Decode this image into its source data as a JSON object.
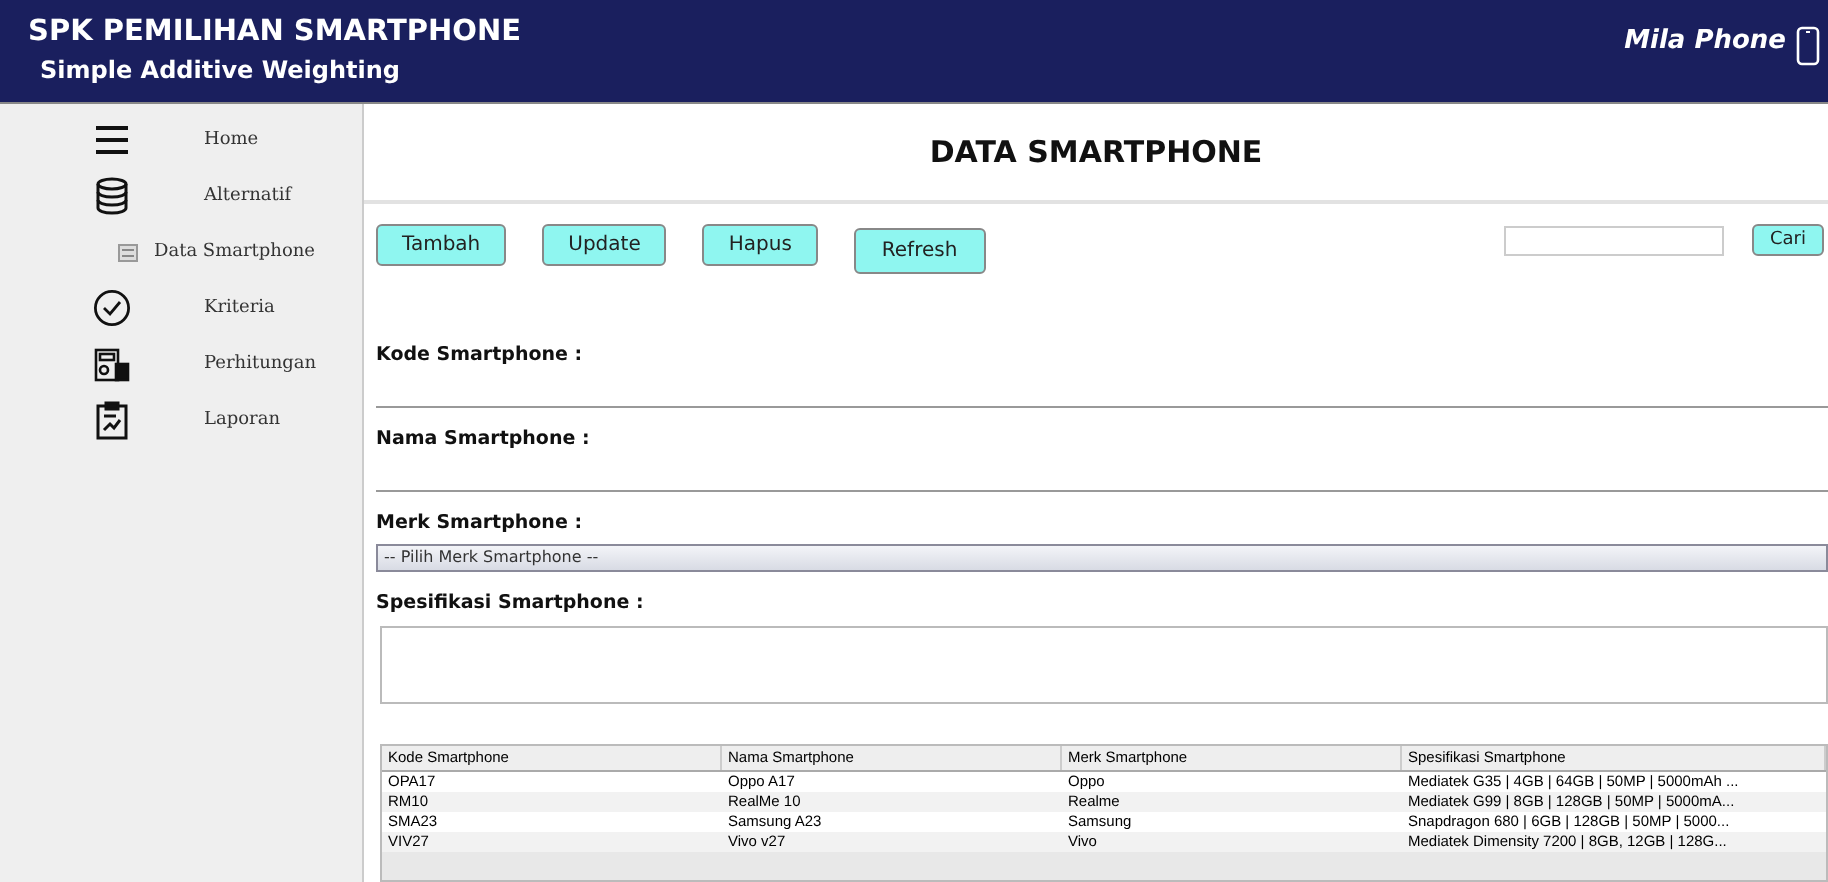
{
  "header": {
    "title": "SPK PEMILIHAN SMARTPHONE",
    "subtitle": "Simple Additive Weighting",
    "brand": "Mila Phone"
  },
  "sidebar": {
    "items": [
      {
        "label": "Home",
        "selected": false
      },
      {
        "label": "Alternatif",
        "selected": false,
        "children": [
          {
            "label": "Data Smartphone",
            "selected": false
          }
        ]
      },
      {
        "label": "Kriteria",
        "selected": false
      },
      {
        "label": "Perhitungan",
        "selected": false
      },
      {
        "label": "Laporan",
        "selected": false
      }
    ]
  },
  "page_title": "DATA SMARTPHONE",
  "buttons": [
    "Tambah",
    "Update",
    "Hapus",
    "Refresh"
  ],
  "search": {
    "button": "Cari"
  },
  "form": [
    {
      "kind": "line",
      "label": "Kode Smartphone :"
    },
    {
      "kind": "line",
      "label": "Nama Smartphone :"
    },
    {
      "kind": "select",
      "label": "Merk Smartphone :",
      "value": "-- Pilih Merk Smartphone --"
    },
    {
      "kind": "textarea",
      "label": "Spesifikasi Smartphone :"
    }
  ],
  "table": {
    "columns": [
      "Kode Smartphone",
      "Nama Smartphone",
      "Merk Smartphone",
      "Spesifikasi Smartphone"
    ],
    "rows": [
      [
        "OPA17",
        "Oppo A17",
        "Oppo",
        "Mediatek G35 | 4GB | 64GB | 50MP | 5000mAh ..."
      ],
      [
        "RM10",
        "RealMe 10",
        "Realme",
        "Mediatek G99 | 8GB | 128GB | 50MP | 5000mA..."
      ],
      [
        "SMA23",
        "Samsung A23",
        "Samsung",
        "Snapdragon 680 | 6GB | 128GB | 50MP | 5000..."
      ],
      [
        "VIV27",
        "Vivo v27",
        "Vivo",
        "Mediatek Dimensity 7200 | 8GB, 12GB | 128G..."
      ]
    ]
  }
}
